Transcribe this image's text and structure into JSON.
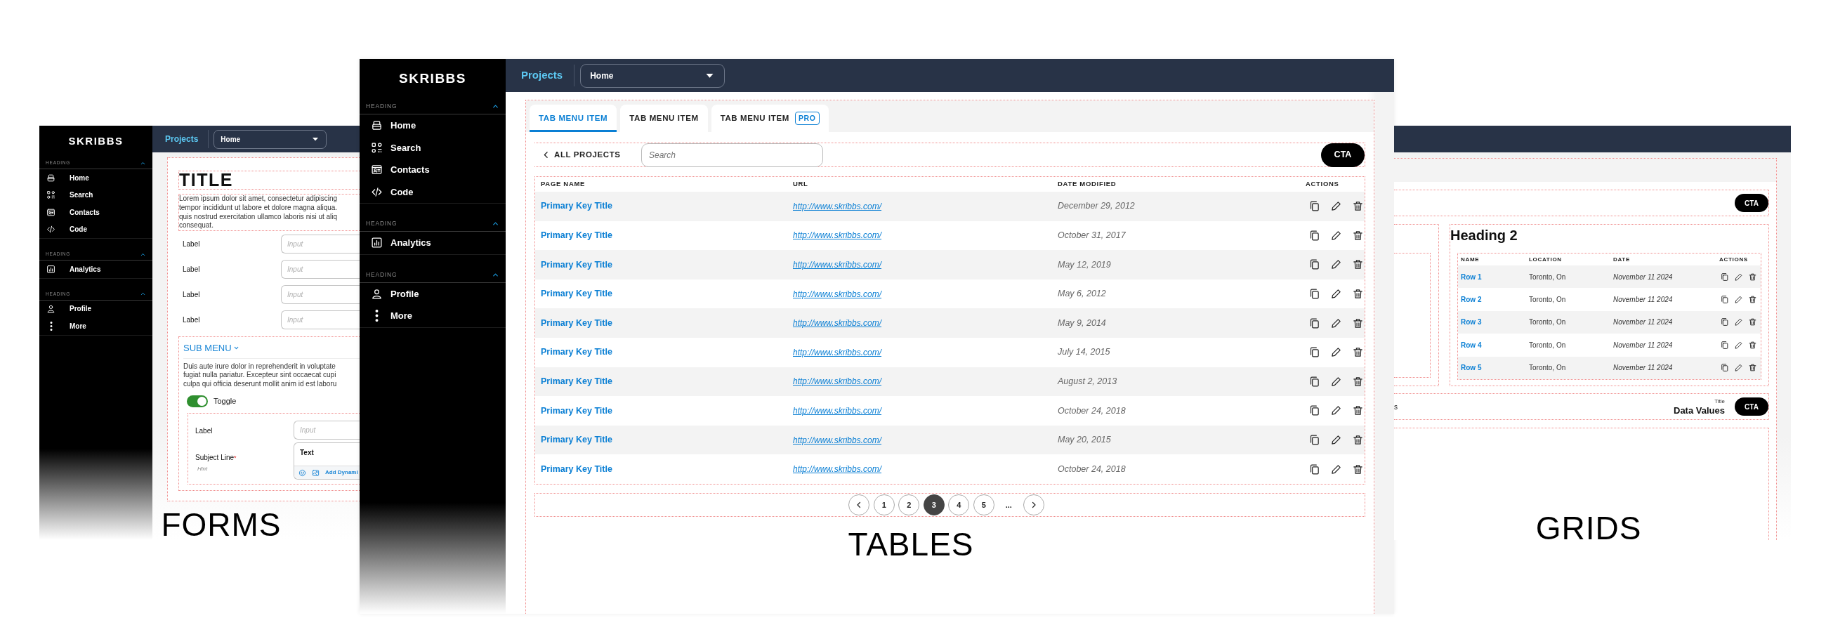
{
  "forms_preview": {
    "brand": "SKRIBBS",
    "sidebar": [
      {
        "heading": "HEADING",
        "expanded": true,
        "items": [
          "Home",
          "Search",
          "Contacts",
          "Code"
        ]
      },
      {
        "heading": "HEADING",
        "expanded": true,
        "items": [
          "Analytics"
        ]
      },
      {
        "heading": "HEADING",
        "expanded": true,
        "items": [
          "Profile",
          "More"
        ]
      }
    ],
    "topbar": {
      "link": "Projects",
      "select": "Home"
    },
    "title": "TITLE",
    "intro": "Lorem ipsum dolor sit amet, consectetur adipiscing\ntempor incididunt ut labore et dolore magna aliqua.\nquis nostrud exercitation ullamco laboris nisi ut aliq\nconsequat.",
    "fields": [
      {
        "label": "Label",
        "placeholder": "Input"
      },
      {
        "label": "Label",
        "placeholder": "Input"
      },
      {
        "label": "Label",
        "placeholder": "Input"
      },
      {
        "label": "Label",
        "placeholder": "Input"
      }
    ],
    "submenu": {
      "label": "SUB MENU",
      "text": "Duis aute irure dolor in reprehenderit in voluptate\nfugiat nulla pariatur. Excepteur sint occaecat cupi\nculpa qui officia deserunt mollit anim id est laboru"
    },
    "toggle": {
      "label": "Toggle",
      "on": true
    },
    "subform": [
      {
        "kind": "input",
        "label": "Label",
        "placeholder": "Input"
      },
      {
        "kind": "editor",
        "label": "Subject Line",
        "required_mark": "*",
        "hint": "Hint",
        "value": "Text",
        "action": "Add Dynami"
      }
    ],
    "caption": "FORMS"
  },
  "tables_preview": {
    "brand": "SKRIBBS",
    "sidebar": [
      {
        "heading": "HEADING",
        "expanded": true,
        "items": [
          "Home",
          "Search",
          "Contacts",
          "Code"
        ]
      },
      {
        "heading": "HEADING",
        "expanded": true,
        "items": [
          "Analytics"
        ]
      },
      {
        "heading": "HEADING",
        "expanded": true,
        "items": [
          "Profile",
          "More"
        ]
      }
    ],
    "topbar": {
      "link": "Projects",
      "select": "Home"
    },
    "tabs": [
      {
        "label": "TAB MENU ITEM",
        "selected": true
      },
      {
        "label": "TAB MENU ITEM",
        "selected": false
      },
      {
        "label": "TAB MENU ITEM",
        "selected": false,
        "badge": "PRO"
      }
    ],
    "back_link": "ALL PROJECTS",
    "search_placeholder": "Search",
    "cta": "CTA",
    "table": {
      "columns": [
        "PAGE NAME",
        "URL",
        "DATE MODIFIED",
        "ACTIONS"
      ],
      "rows": [
        {
          "page_name": "Primary Key Title",
          "url": "http://www.skribbs.com/",
          "date": "December 29, 2012"
        },
        {
          "page_name": "Primary Key Title",
          "url": "http://www.skribbs.com/",
          "date": "October 31, 2017"
        },
        {
          "page_name": "Primary Key Title",
          "url": "http://www.skribbs.com/",
          "date": "May 12, 2019"
        },
        {
          "page_name": "Primary Key Title",
          "url": "http://www.skribbs.com/",
          "date": "May 6, 2012"
        },
        {
          "page_name": "Primary Key Title",
          "url": "http://www.skribbs.com/",
          "date": "May 9, 2014"
        },
        {
          "page_name": "Primary Key Title",
          "url": "http://www.skribbs.com/",
          "date": "July 14, 2015"
        },
        {
          "page_name": "Primary Key Title",
          "url": "http://www.skribbs.com/",
          "date": "August 2, 2013"
        },
        {
          "page_name": "Primary Key Title",
          "url": "http://www.skribbs.com/",
          "date": "October 24, 2018"
        },
        {
          "page_name": "Primary Key Title",
          "url": "http://www.skribbs.com/",
          "date": "May 20, 2015"
        },
        {
          "page_name": "Primary Key Title",
          "url": "http://www.skribbs.com/",
          "date": "October 24, 2018"
        }
      ]
    },
    "pagination": {
      "pages": [
        {
          "label": "1",
          "selected": false
        },
        {
          "label": "2",
          "selected": false
        },
        {
          "label": "3",
          "selected": true
        },
        {
          "label": "4",
          "selected": false
        },
        {
          "label": "5",
          "selected": false
        }
      ],
      "ellipsis": "..."
    },
    "caption": "TABLES"
  },
  "grids_preview": {
    "cta": "CTA",
    "heading": "Heading 2",
    "table": {
      "columns": [
        "NAME",
        "LOCATION",
        "DATE",
        "ACTIONS"
      ],
      "rows": [
        {
          "name": "Row 1",
          "location": "Toronto, On",
          "date": "November 11 2024"
        },
        {
          "name": "Row 2",
          "location": "Toronto, On",
          "date": "November 11 2024"
        },
        {
          "name": "Row 3",
          "location": "Toronto, On",
          "date": "November 11 2024"
        },
        {
          "name": "Row 4",
          "location": "Toronto, On",
          "date": "November 11 2024"
        },
        {
          "name": "Row 5",
          "location": "Toronto, On",
          "date": "November 11 2024"
        }
      ]
    },
    "data_header": {
      "fragment": "s",
      "title": "Title",
      "value": "Data Values",
      "cta": "CTA"
    },
    "caption": "GRIDS"
  }
}
